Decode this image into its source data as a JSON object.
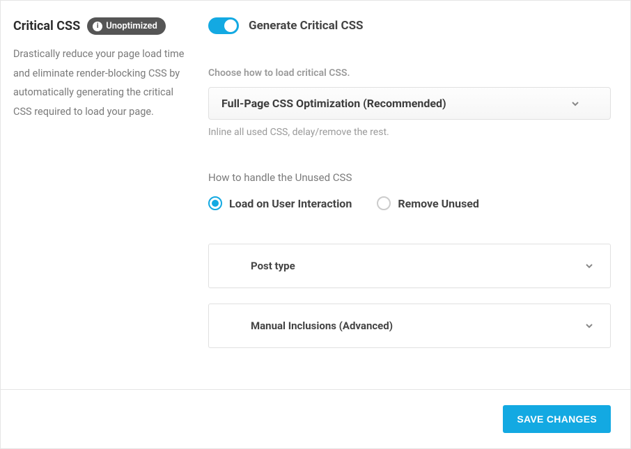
{
  "left": {
    "title": "Critical CSS",
    "badge": "Unoptimized",
    "description": "Drastically reduce your page load time and eliminate render-blocking CSS by automatically generating the critical CSS required to load your page."
  },
  "toggle": {
    "label": "Generate Critical CSS",
    "on": true
  },
  "loadMethod": {
    "label": "Choose how to load critical CSS.",
    "selected": "Full-Page CSS Optimization (Recommended)",
    "helper": "Inline all used CSS, delay/remove the rest."
  },
  "unusedCss": {
    "label": "How to handle the Unused CSS",
    "options": [
      {
        "label": "Load on User Interaction",
        "selected": true
      },
      {
        "label": "Remove Unused",
        "selected": false
      }
    ]
  },
  "accordions": [
    {
      "title": "Post type"
    },
    {
      "title": "Manual Inclusions (Advanced)"
    }
  ],
  "footer": {
    "save": "SAVE CHANGES"
  }
}
